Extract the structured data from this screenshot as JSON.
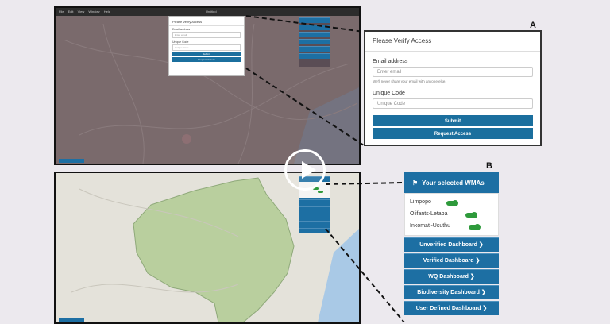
{
  "figure_letters": {
    "a": "A",
    "b": "B"
  },
  "screenshot_a": {
    "menu": [
      "File",
      "Edit",
      "View",
      "Window",
      "Help"
    ],
    "title": "Untitled",
    "modal_title": "Please Verify Access",
    "email_label": "Email address",
    "email_placeholder": "Enter email",
    "code_label": "Unique Code",
    "code_placeholder": "Unique Code",
    "submit": "Submit",
    "request": "Request Access"
  },
  "callout_a": {
    "title": "Please Verify Access",
    "email_label": "Email address",
    "email_placeholder": "Enter email",
    "email_help": "We'll never share your email with anyone else.",
    "code_label": "Unique Code",
    "code_placeholder": "Unique Code",
    "submit_label": "Submit",
    "request_label": "Request Access"
  },
  "callout_b": {
    "header": "Your selected WMAs",
    "header_icon": "map-icon",
    "wmas": [
      "Limpopo",
      "Olifants-Letaba",
      "Inkomati-Usuthu"
    ],
    "dashboards": [
      "Unverified Dashboard",
      "Verified Dashboard",
      "WQ Dashboard",
      "Biodiversity Dashboard",
      "User Defined Dashboard"
    ],
    "chevron": "❯"
  },
  "colors": {
    "accent_blue": "#1d6fa3",
    "toggle_green": "#2e9a3b",
    "map_dark": "#7a6a6c",
    "map_light": "#e4e2da",
    "region_green": "#b9cf9e"
  },
  "video_control": "play-icon"
}
